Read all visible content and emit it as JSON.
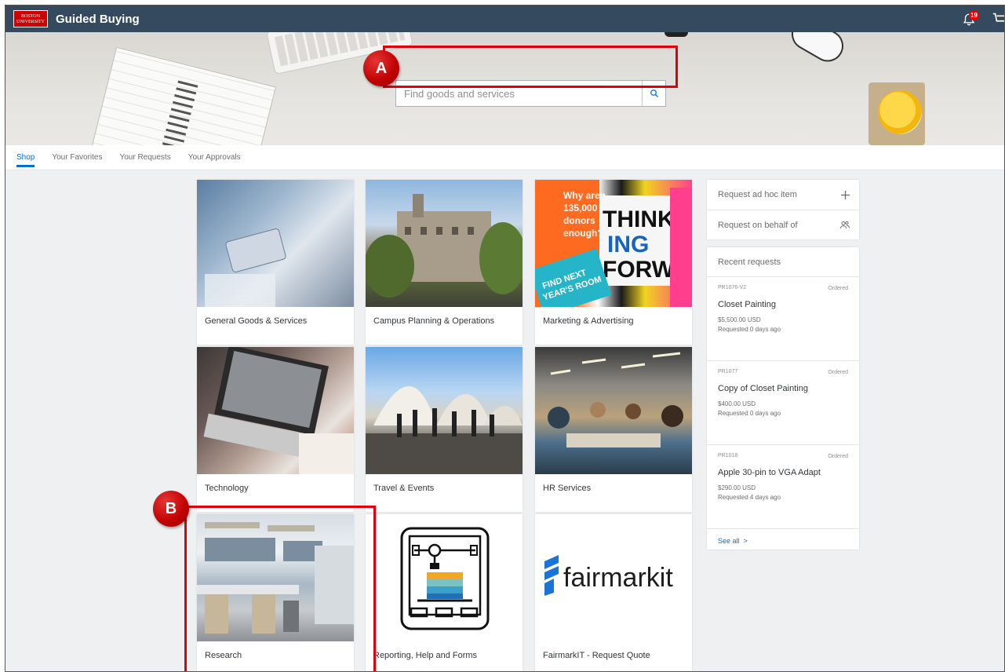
{
  "shell": {
    "logo_text": "BOSTON UNIVERSITY",
    "title": "Guided Buying",
    "notification_count": "19"
  },
  "search": {
    "placeholder": "Find goods and services"
  },
  "annotations": {
    "a": "A",
    "b": "B",
    "color": "#e0000b"
  },
  "tabs": [
    {
      "label": "Shop",
      "active": true
    },
    {
      "label": "Your Favorites"
    },
    {
      "label": "Your Requests"
    },
    {
      "label": "Your Approvals"
    }
  ],
  "categories": [
    {
      "label": "General Goods & Services"
    },
    {
      "label": "Campus Planning & Operations"
    },
    {
      "label": "Marketing & Advertising",
      "image_text": [
        "Why aren",
        "135,000",
        "donors",
        "enough?",
        "THINK",
        "ING",
        "FORW",
        "FIND NEXT",
        "YEAR'S ROOM"
      ]
    },
    {
      "label": "Technology"
    },
    {
      "label": "Travel & Events"
    },
    {
      "label": "HR Services"
    },
    {
      "label": "Research"
    },
    {
      "label": "Reporting, Help and Forms"
    },
    {
      "label": "FairmarkIT - Request Quote",
      "logo_text": "fairmarkit"
    }
  ],
  "actions": {
    "adhoc": "Request ad hoc item",
    "behalf": "Request on behalf of"
  },
  "recent": {
    "title": "Recent requests",
    "items": [
      {
        "id": "PR1076-V2",
        "status": "Ordered",
        "title": "Closet Painting",
        "price": "$5,500.00 USD",
        "when": "Requested 0 days ago"
      },
      {
        "id": "PR1077",
        "status": "Ordered",
        "title": "Copy of Closet Painting",
        "price": "$400.00 USD",
        "when": "Requested 0 days ago"
      },
      {
        "id": "PR1018",
        "status": "Ordered",
        "title": "Apple 30-pin to VGA Adapt",
        "price": "$290.00 USD",
        "when": "Requested 4 days ago"
      }
    ],
    "see_all": "See all"
  },
  "colors": {
    "shellbar": "#354a5f",
    "accent": "#0a6ed1",
    "annotation": "#e0000b"
  }
}
